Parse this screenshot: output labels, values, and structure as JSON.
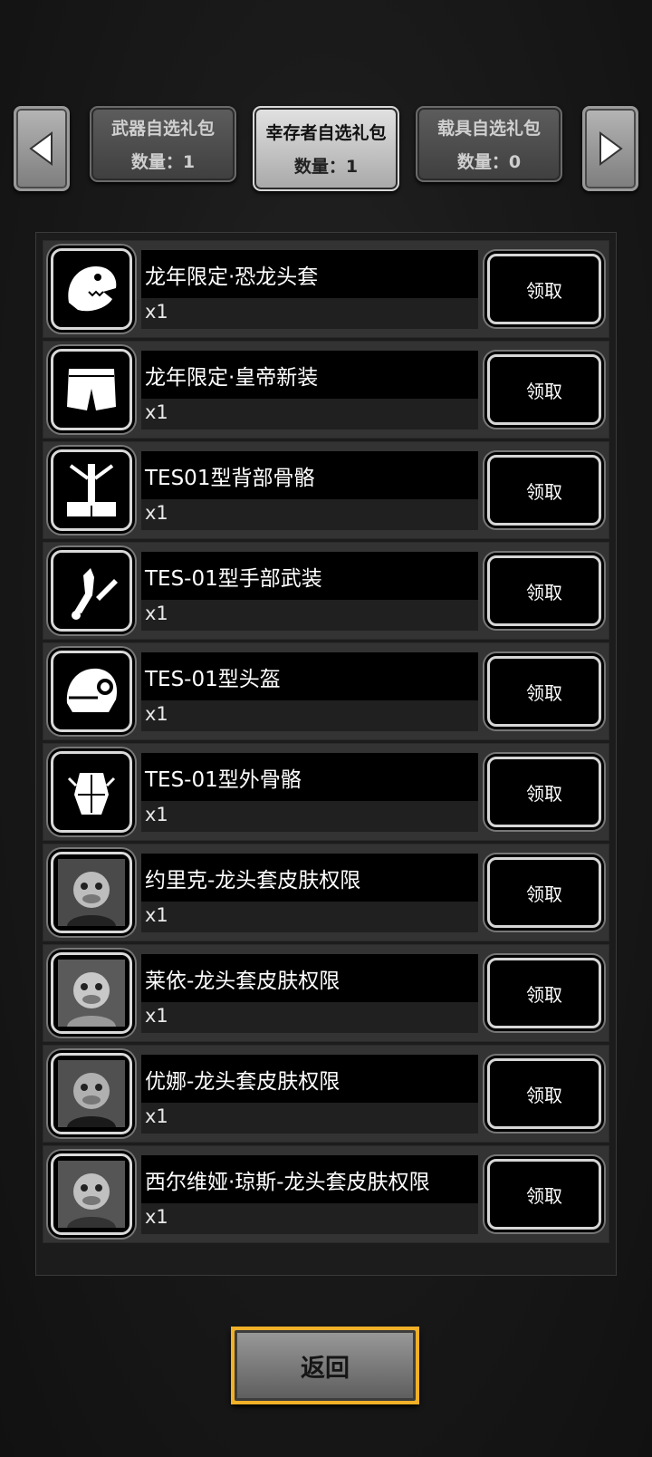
{
  "tabs": [
    {
      "label": "武器自选礼包",
      "count": "数量：1",
      "active": false
    },
    {
      "label": "幸存者自选礼包",
      "count": "数量：1",
      "active": true
    },
    {
      "label": "载具自选礼包",
      "count": "数量：0",
      "active": false
    }
  ],
  "items": [
    {
      "name": "龙年限定·恐龙头套",
      "qty": "x1",
      "claim": "领取",
      "icon": "dinosaur-head-icon"
    },
    {
      "name": "龙年限定·皇帝新装",
      "qty": "x1",
      "claim": "领取",
      "icon": "shorts-icon"
    },
    {
      "name": "TES01型背部骨骼",
      "qty": "x1",
      "claim": "领取",
      "icon": "back-exoskeleton-icon"
    },
    {
      "name": "TES-01型手部武装",
      "qty": "x1",
      "claim": "领取",
      "icon": "arm-weapon-icon"
    },
    {
      "name": "TES-01型头盔",
      "qty": "x1",
      "claim": "领取",
      "icon": "helmet-icon"
    },
    {
      "name": "TES-01型外骨骼",
      "qty": "x1",
      "claim": "领取",
      "icon": "exoskeleton-icon"
    },
    {
      "name": "约里克-龙头套皮肤权限",
      "qty": "x1",
      "claim": "领取",
      "icon": "dragon-skin-portrait-icon"
    },
    {
      "name": "莱依-龙头套皮肤权限",
      "qty": "x1",
      "claim": "领取",
      "icon": "dragon-skin-portrait-icon"
    },
    {
      "name": "优娜-龙头套皮肤权限",
      "qty": "x1",
      "claim": "领取",
      "icon": "dragon-skin-portrait-icon"
    },
    {
      "name": "西尔维娅·琼斯-龙头套皮肤权限",
      "qty": "x1",
      "claim": "领取",
      "icon": "dragon-skin-portrait-icon"
    }
  ],
  "back_label": "返回",
  "colors": {
    "background": "#141414",
    "row": "#333333",
    "accent_gold": "#f0b028"
  }
}
